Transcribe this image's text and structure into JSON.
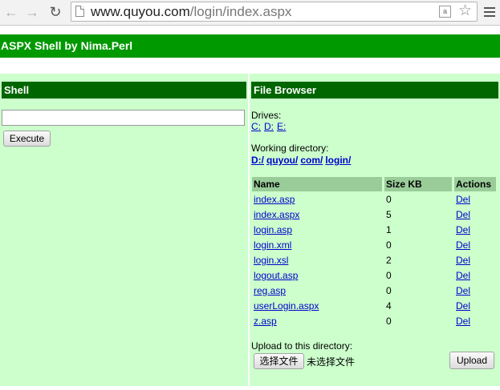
{
  "browser": {
    "back_icon": "arrow-left",
    "forward_icon": "arrow-right",
    "reload_icon": "reload",
    "url_host": "www.quyou.com",
    "url_path": "/login/index.aspx",
    "translate_label": "a"
  },
  "banner": {
    "title": "ASPX Shell by Nima.Perl"
  },
  "shell": {
    "title": "Shell",
    "command_value": "",
    "execute_label": "Execute"
  },
  "file_browser": {
    "title": "File Browser",
    "drives_label": "Drives:",
    "drives": [
      "C:",
      "D:",
      "E:"
    ],
    "working_dir_label": "Working directory:",
    "path_parts": [
      "D:/",
      "quyou/",
      "com/",
      "login/"
    ],
    "columns": {
      "name": "Name",
      "size": "Size KB",
      "actions": "Actions"
    },
    "files": [
      {
        "name": "index.asp",
        "size": "0",
        "action": "Del"
      },
      {
        "name": "index.aspx",
        "size": "5",
        "action": "Del"
      },
      {
        "name": "login.asp",
        "size": "1",
        "action": "Del"
      },
      {
        "name": "login.xml",
        "size": "0",
        "action": "Del"
      },
      {
        "name": "login.xsl",
        "size": "2",
        "action": "Del"
      },
      {
        "name": "logout.asp",
        "size": "0",
        "action": "Del"
      },
      {
        "name": "reg.asp",
        "size": "0",
        "action": "Del"
      },
      {
        "name": "userLogin.aspx",
        "size": "4",
        "action": "Del"
      },
      {
        "name": "z.asp",
        "size": "0",
        "action": "Del"
      }
    ],
    "upload_label": "Upload to this directory:",
    "choose_file_label": "选择文件",
    "no_file_text": "未选择文件",
    "upload_button": "Upload"
  },
  "colors": {
    "banner": "#009900",
    "panel_bg": "#ccffcc",
    "panel_header": "#006600",
    "table_header": "#99cc99",
    "link": "#0000cc"
  }
}
